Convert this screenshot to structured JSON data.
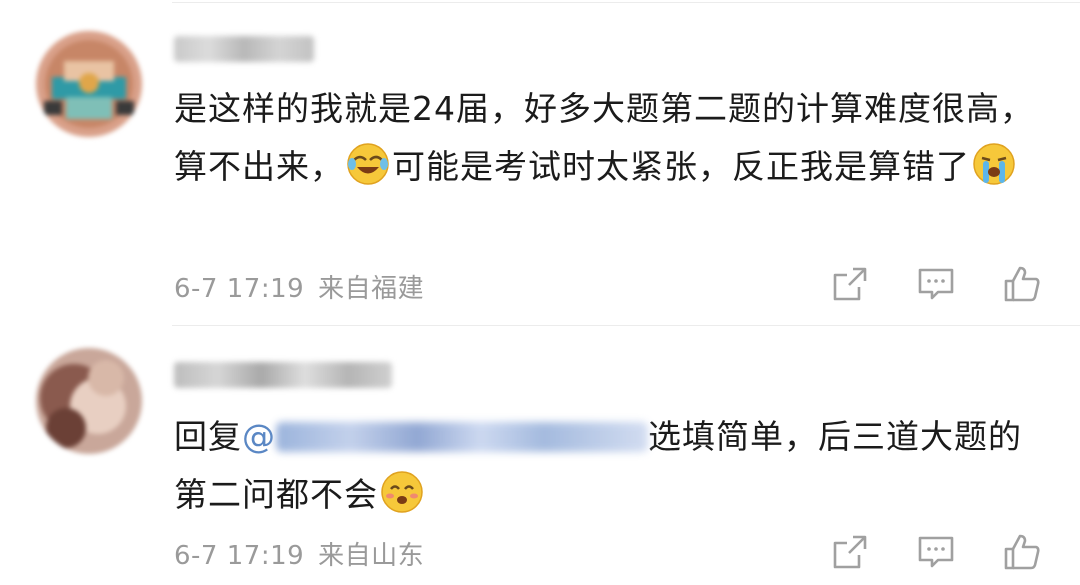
{
  "comments": [
    {
      "text_parts": [
        "是这样的我就是24届，好多大题第二题的计算难度很高，算不出来，",
        "可能是考试时太紧张，反正我是算错了"
      ],
      "emojis": [
        "laughing-crying-emoji",
        "loudly-crying-emoji"
      ],
      "date": "6-7 17:19",
      "location": "来自福建",
      "actions": [
        "share-icon",
        "comment-icon",
        "like-icon"
      ]
    },
    {
      "reply_prefix": "回复",
      "mention_at": "@",
      "text_parts": [
        "选填简单，后三道大题的第二问都不会"
      ],
      "emojis": [
        "blushing-smile-emoji"
      ],
      "date": "6-7 17:19",
      "location": "来自山东",
      "actions": [
        "share-icon",
        "comment-icon",
        "like-icon"
      ]
    }
  ],
  "colors": {
    "text": "#1b1b1b",
    "meta": "#9a9a9a",
    "mention": "#5a87c4",
    "icon": "#a0a0a0",
    "divider": "#ececec"
  }
}
